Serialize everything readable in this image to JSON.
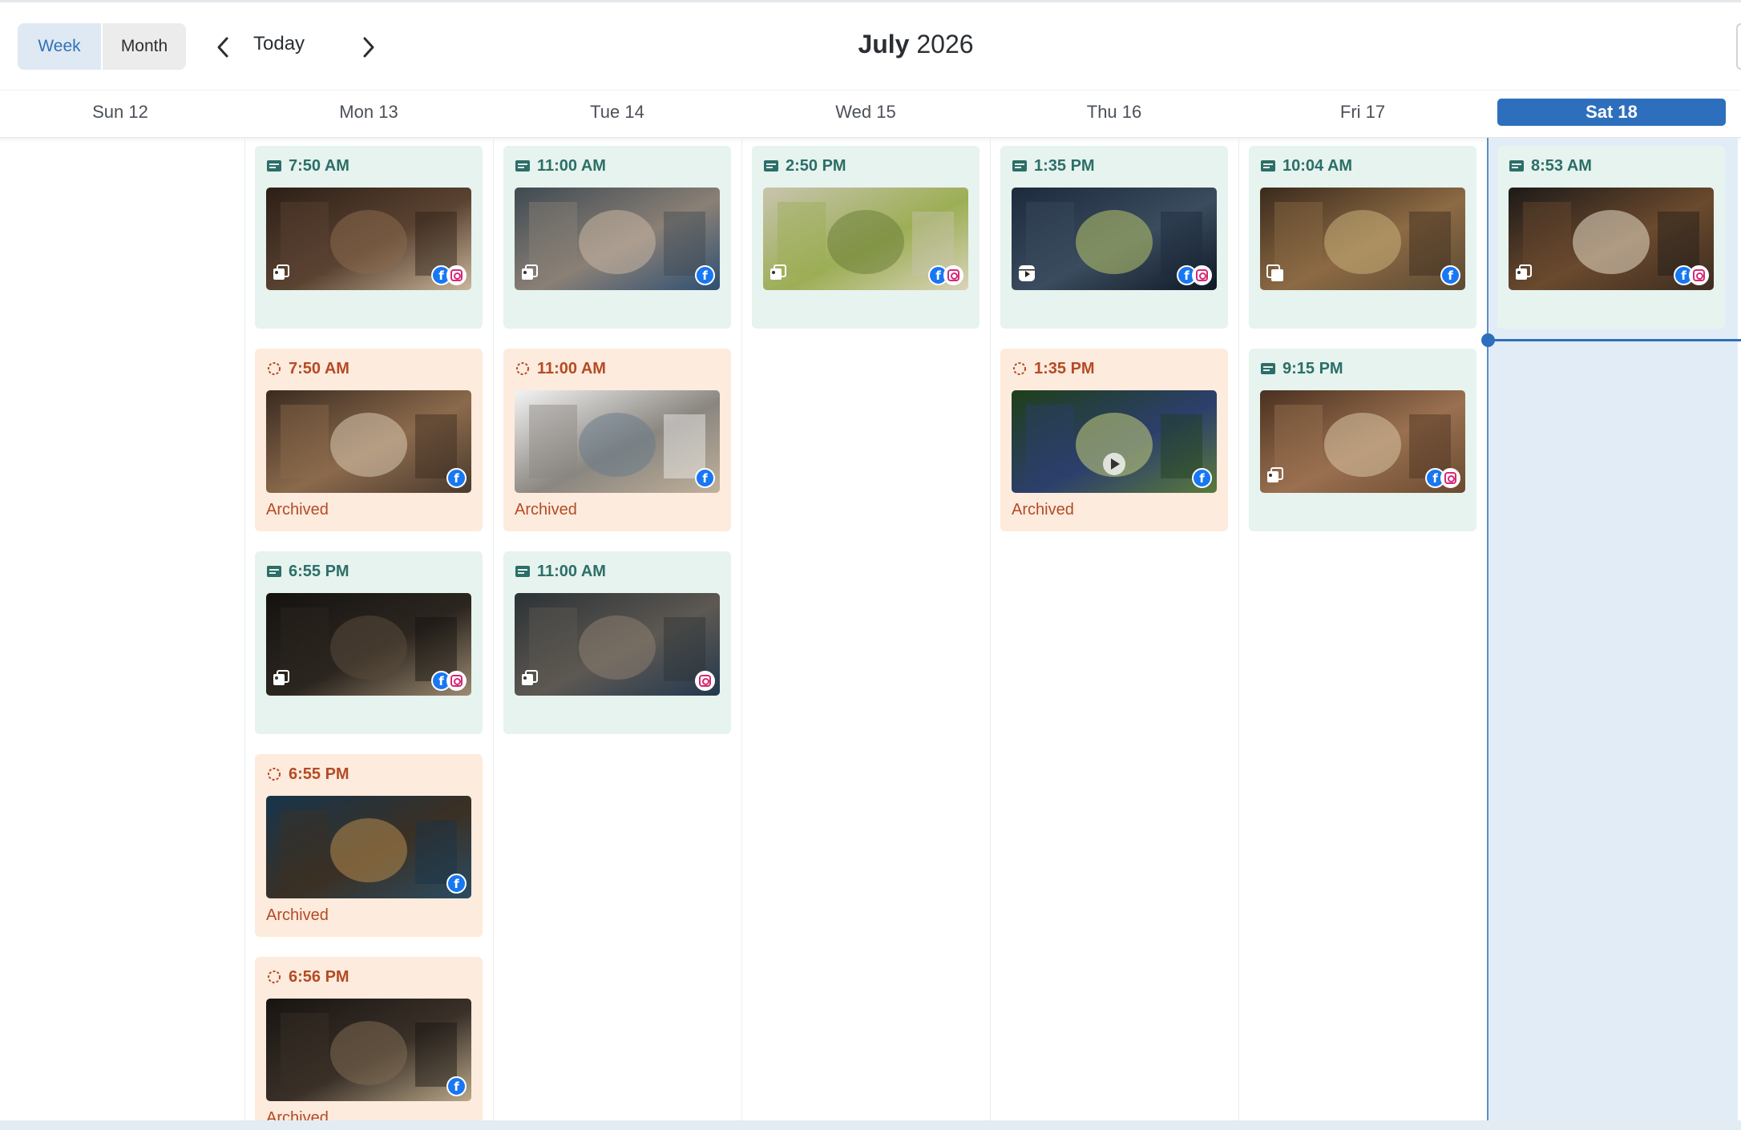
{
  "toolbar": {
    "views": [
      "Week",
      "Month"
    ],
    "active_view": "Week",
    "today_label": "Today",
    "month": "July",
    "year": "2026"
  },
  "days": [
    {
      "label": "Sun 12",
      "today": false
    },
    {
      "label": "Mon 13",
      "today": false
    },
    {
      "label": "Tue 14",
      "today": false
    },
    {
      "label": "Wed 15",
      "today": false
    },
    {
      "label": "Thu 16",
      "today": false
    },
    {
      "label": "Fri 17",
      "today": false
    },
    {
      "label": "Sat 18",
      "today": true
    }
  ],
  "posts": [
    {
      "day": 1,
      "slot": 0,
      "time": "7:50 AM",
      "status": "published",
      "status_label": "",
      "media": "gallery",
      "networks": [
        "facebook",
        "instagram"
      ],
      "thumb": "coffee-cup-table"
    },
    {
      "day": 1,
      "slot": 1,
      "time": "7:50 AM",
      "status": "archived",
      "status_label": "Archived",
      "media": "none",
      "networks": [
        "facebook"
      ],
      "thumb": "shop-interior"
    },
    {
      "day": 1,
      "slot": 2,
      "time": "6:55 PM",
      "status": "published",
      "status_label": "",
      "media": "gallery",
      "networks": [
        "facebook",
        "instagram"
      ],
      "thumb": "dark-cafe"
    },
    {
      "day": 1,
      "slot": 3,
      "time": "6:55 PM",
      "status": "archived",
      "status_label": "Archived",
      "media": "none",
      "networks": [
        "facebook"
      ],
      "thumb": "cafe-night"
    },
    {
      "day": 1,
      "slot": 4,
      "time": "6:56 PM",
      "status": "archived",
      "status_label": "Archived",
      "media": "none",
      "networks": [
        "facebook"
      ],
      "thumb": "dark-cafe-latte"
    },
    {
      "day": 2,
      "slot": 0,
      "time": "11:00 AM",
      "status": "published",
      "status_label": "",
      "media": "gallery",
      "networks": [
        "facebook"
      ],
      "thumb": "people-street"
    },
    {
      "day": 2,
      "slot": 1,
      "time": "11:00 AM",
      "status": "archived",
      "status_label": "Archived",
      "media": "none",
      "networks": [
        "facebook"
      ],
      "thumb": "meme-text"
    },
    {
      "day": 2,
      "slot": 2,
      "time": "11:00 AM",
      "status": "published",
      "status_label": "",
      "media": "gallery",
      "networks": [
        "instagram"
      ],
      "thumb": "people-street-dark"
    },
    {
      "day": 3,
      "slot": 0,
      "time": "2:50 PM",
      "status": "published",
      "status_label": "",
      "media": "gallery",
      "networks": [
        "facebook",
        "instagram"
      ],
      "thumb": "matcha-drinks"
    },
    {
      "day": 4,
      "slot": 0,
      "time": "1:35 PM",
      "status": "published",
      "status_label": "",
      "media": "reel",
      "networks": [
        "facebook",
        "instagram"
      ],
      "thumb": "matcha-dark"
    },
    {
      "day": 4,
      "slot": 1,
      "time": "1:35 PM",
      "status": "archived",
      "status_label": "Archived",
      "media": "video",
      "networks": [
        "facebook"
      ],
      "thumb": "matcha-hand"
    },
    {
      "day": 5,
      "slot": 0,
      "time": "10:04 AM",
      "status": "published",
      "status_label": "",
      "media": "carousel",
      "networks": [
        "facebook"
      ],
      "thumb": "pastries"
    },
    {
      "day": 5,
      "slot": 1,
      "time": "9:15 PM",
      "status": "published",
      "status_label": "",
      "media": "gallery",
      "networks": [
        "facebook",
        "instagram"
      ],
      "thumb": "order-now"
    },
    {
      "day": 6,
      "slot": 0,
      "time": "8:53 AM",
      "status": "published",
      "status_label": "",
      "media": "gallery",
      "networks": [
        "facebook",
        "instagram"
      ],
      "thumb": "latte-art"
    }
  ],
  "icons": {
    "prev": "chevron-left-icon",
    "next": "chevron-right-icon",
    "published": "post-icon",
    "archived": "pending-circle-icon"
  },
  "colors": {
    "accent": "#2e6fbd",
    "published_bg": "#e6f3ee",
    "archived_bg": "#fdebdd",
    "published_text": "#2d6e68",
    "archived_text": "#b34b26"
  }
}
